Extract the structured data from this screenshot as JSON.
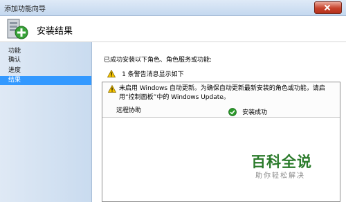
{
  "window": {
    "title": "添加功能向导"
  },
  "header": {
    "title": "安装结果"
  },
  "sidebar": {
    "items": [
      {
        "label": "功能"
      },
      {
        "label": "确认"
      },
      {
        "label": "进度"
      },
      {
        "label": "结果",
        "active": true
      }
    ]
  },
  "main": {
    "intro": "已成功安装以下角色、角色服务或功能:",
    "warning_summary": "1 条警告消息显示如下",
    "results": {
      "warning_message": "未启用 Windows 自动更新。为确保自动更新最新安装的角色或功能，请启用“控制面板”中的 Windows Update。",
      "rows": [
        {
          "name": "远程协助",
          "status": "安装成功"
        }
      ]
    }
  },
  "watermark": {
    "title": "百科全说",
    "subtitle": "助你轻松解决"
  },
  "colors": {
    "selection": "#3399ff",
    "success": "#2a9a2a",
    "warning": "#f2c200"
  }
}
